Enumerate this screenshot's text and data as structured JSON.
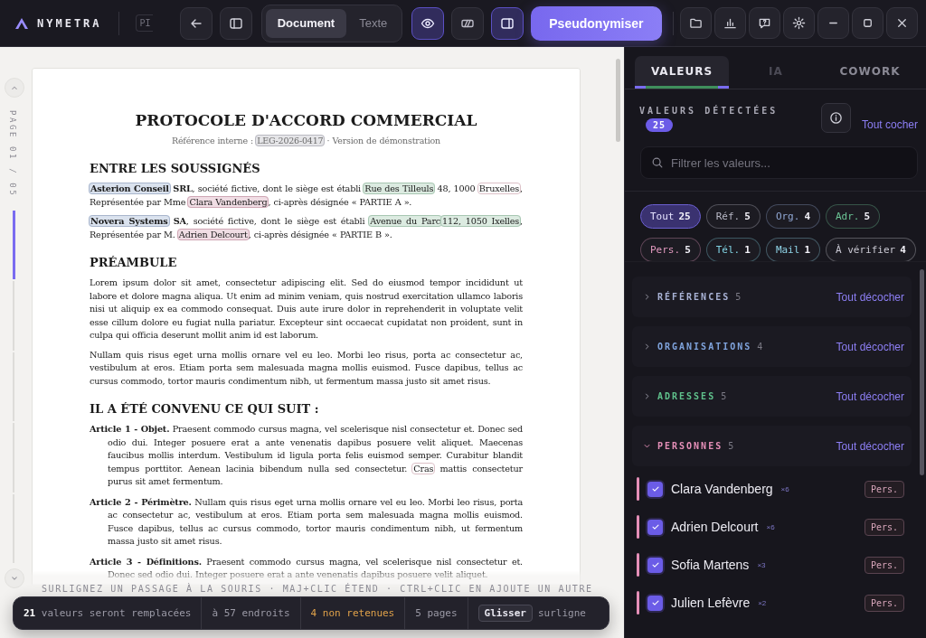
{
  "app": {
    "name": "NYMETRA"
  },
  "toolbar": {
    "file_tab": "PI",
    "view_modes": [
      {
        "label": "Document",
        "selected": true
      },
      {
        "label": "Texte",
        "selected": false
      }
    ],
    "toggles": [
      {
        "kind": "eye",
        "on": true
      },
      {
        "kind": "stripes",
        "on": false
      },
      {
        "kind": "panel",
        "on": true
      }
    ],
    "primary_button": "Pseudonymiser"
  },
  "document": {
    "page_indicator": "PAGE 01 / 05",
    "title": "PROTOCOLE D'ACCORD COMMERCIAL",
    "subtitle": [
      {
        "text": "Référence interne : "
      },
      {
        "text": "LEG-2026-0417",
        "kind": "ref"
      },
      {
        "text": " · Version de démonstration"
      }
    ],
    "sections": [
      {
        "heading": "ENTRE LES SOUSSIGNÉS",
        "paragraphs": [
          {
            "kind": "text",
            "segments": [
              {
                "text": "Asterion Conseil",
                "kind": "org"
              },
              {
                "text": " SRL",
                "kind": "strong"
              },
              {
                "text": ", société fictive, dont le siège est établi "
              },
              {
                "text": "Rue des Tilleuls",
                "kind": "adr"
              },
              {
                "text": " 48, 1000 "
              },
              {
                "text": "Bruxelles",
                "kind": "check"
              },
              {
                "text": ", Représentée par Mme "
              },
              {
                "text": "Clara Vandenberg",
                "kind": "pers"
              },
              {
                "text": ", ci-après désignée « PARTIE A »."
              }
            ]
          },
          {
            "kind": "text",
            "segments": [
              {
                "text": "Novera Systems",
                "kind": "org"
              },
              {
                "text": " SA",
                "kind": "strong"
              },
              {
                "text": ", société fictive, dont le siège est établi "
              },
              {
                "text": "Avenue du Parc",
                "kind": "adr"
              },
              {
                "text": "112, 1050 Ixelles",
                "kind": "adr"
              },
              {
                "text": ", Représentée par M. "
              },
              {
                "text": "Adrien Delcourt",
                "kind": "pers"
              },
              {
                "text": ", ci-après désignée « PARTIE B »."
              }
            ]
          }
        ]
      },
      {
        "heading": "PRÉAMBULE",
        "paragraphs": [
          {
            "kind": "text",
            "segments": [
              {
                "text": "Lorem ipsum dolor sit amet, consectetur adipiscing elit. Sed do eiusmod tempor incididunt ut labore et dolore magna aliqua. Ut enim ad minim veniam, quis nostrud exercitation ullamco laboris nisi ut aliquip ex ea commodo consequat. Duis aute irure dolor in reprehenderit in voluptate velit esse cillum dolore eu fugiat nulla pariatur. Excepteur sint occaecat cupidatat non proident, sunt in culpa qui officia deserunt mollit anim id est laborum."
              }
            ]
          },
          {
            "kind": "text",
            "segments": [
              {
                "text": "Nullam quis risus eget urna mollis ornare vel eu leo. Morbi leo risus, porta ac consectetur ac, vestibulum at eros. Etiam porta sem malesuada magna mollis euismod. Fusce dapibus, tellus ac cursus commodo, tortor mauris condimentum nibh, ut fermentum massa justo sit amet risus."
              }
            ]
          }
        ]
      },
      {
        "heading": "IL A ÉTÉ CONVENU CE QUI SUIT :",
        "paragraphs": [
          {
            "kind": "article",
            "segments": [
              {
                "text": "Article 1 - Objet.",
                "kind": "strong"
              },
              {
                "text": " Praesent commodo cursus magna, vel scelerisque nisl consectetur et. Donec sed odio dui. Integer posuere erat a ante venenatis dapibus posuere velit aliquet. Maecenas faucibus mollis interdum. Vestibulum id ligula porta felis euismod semper. Curabitur blandit tempus porttitor. Aenean lacinia bibendum nulla sed consectetur. "
              },
              {
                "text": "Cras",
                "kind": "check"
              },
              {
                "text": " mattis consectetur purus sit amet fermentum."
              }
            ]
          },
          {
            "kind": "article",
            "segments": [
              {
                "text": "Article 2 - Périmètre.",
                "kind": "strong"
              },
              {
                "text": " Nullam quis risus eget urna mollis ornare vel eu leo. Morbi leo risus, porta ac consectetur ac, vestibulum at eros. Etiam porta sem malesuada magna mollis euismod. Fusce dapibus, tellus ac cursus commodo, tortor mauris condimentum nibh, ut fermentum massa justo sit amet risus."
              }
            ]
          },
          {
            "kind": "article",
            "segments": [
              {
                "text": "Article 3 - Définitions.",
                "kind": "strong"
              },
              {
                "text": " Praesent commodo cursus magna, vel scelerisque nisl consectetur et. Donec sed odio dui. Integer posuere erat a ante venenatis dapibus posuere velit aliquet."
              }
            ]
          }
        ]
      }
    ],
    "hint": "SURLIGNEZ UN PASSAGE À LA SOURIS · MAJ+CLIC ÉTEND · CTRL+CLIC EN AJOUTE UN AUTRE",
    "status": [
      {
        "kind": "normal",
        "text": "**21** valeurs seront remplacées"
      },
      {
        "kind": "normal",
        "text": "à 57 endroits"
      },
      {
        "kind": "warning",
        "text": "4 non retenues"
      },
      {
        "kind": "normal",
        "text": "5 pages"
      }
    ],
    "key": "Glisser",
    "key_hint": "surligne"
  },
  "values_panel": {
    "tabs": [
      {
        "label": "VALEURS",
        "selected": true,
        "disabled": false
      },
      {
        "label": "IA",
        "selected": false,
        "disabled": true
      },
      {
        "label": "COWORK",
        "selected": false,
        "disabled": false
      }
    ],
    "heading": "VALEURS DÉTECTÉES",
    "count": "25",
    "action": "Tout cocher",
    "search": {
      "placeholder": "Filtrer les valeurs..."
    },
    "chips": [
      {
        "label": "Tout",
        "count": "25",
        "selected": true,
        "color": "#e6e4ff"
      },
      {
        "label": "Réf.",
        "count": "5",
        "selected": false,
        "color": "#b8b8c6"
      },
      {
        "label": "Org.",
        "count": "4",
        "selected": false,
        "color": "#92a9d6"
      },
      {
        "label": "Adr.",
        "count": "5",
        "selected": false,
        "color": "#6cc596"
      },
      {
        "label": "Pers.",
        "count": "5",
        "selected": false,
        "color": "#e39ac0"
      },
      {
        "label": "Tél.",
        "count": "1",
        "selected": false,
        "color": "#7fd0e0"
      },
      {
        "label": "Mail",
        "count": "1",
        "selected": false,
        "color": "#8fd3e6"
      },
      {
        "label": "À vérifier",
        "count": "4",
        "selected": false,
        "color": "#c9c8d2"
      }
    ],
    "groups": [
      {
        "title": "RÉFÉRENCES",
        "count": "5",
        "action": "Tout décocher",
        "expanded": false,
        "color": "#a9b3d6"
      },
      {
        "title": "ORGANISATIONS",
        "count": "4",
        "action": "Tout décocher",
        "expanded": false,
        "color": "#7fa3dc"
      },
      {
        "title": "ADRESSES",
        "count": "5",
        "action": "Tout décocher",
        "expanded": false,
        "color": "#5fc08b"
      },
      {
        "title": "PERSONNES",
        "count": "5",
        "action": "Tout décocher",
        "expanded": true,
        "color": "#e58fb8",
        "items": [
          {
            "name": "Clara Vandenberg",
            "occurrences": "×6",
            "checked": true,
            "tag": "Pers."
          },
          {
            "name": "Adrien Delcourt",
            "occurrences": "×6",
            "checked": true,
            "tag": "Pers."
          },
          {
            "name": "Sofia Martens",
            "occurrences": "×3",
            "checked": true,
            "tag": "Pers."
          },
          {
            "name": "Julien Lefèvre",
            "occurrences": "×2",
            "checked": true,
            "tag": "Pers."
          }
        ]
      }
    ]
  }
}
